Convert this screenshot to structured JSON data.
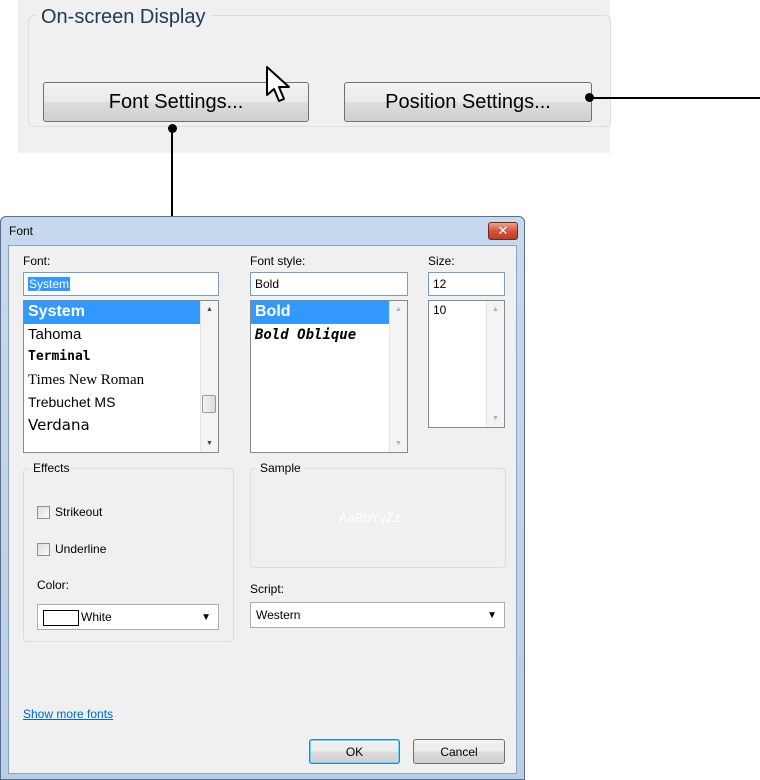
{
  "osd": {
    "group_title": "On-screen Display",
    "font_settings_label": "Font Settings...",
    "position_settings_label": "Position Settings..."
  },
  "dialog": {
    "title": "Font",
    "close_glyph": "✕",
    "font": {
      "label": "Font:",
      "value": "System",
      "items": [
        "System",
        "Tahoma",
        "Terminal",
        "Times New Roman",
        "Trebuchet MS",
        "Verdana"
      ],
      "selected": "System"
    },
    "style": {
      "label": "Font style:",
      "value": "Bold",
      "items": [
        "Bold",
        "Bold Oblique"
      ],
      "selected": "Bold"
    },
    "size": {
      "label": "Size:",
      "value": "12",
      "items": [
        "10"
      ]
    },
    "effects": {
      "title": "Effects",
      "strikeout_label": "Strikeout",
      "strikeout_checked": false,
      "underline_label": "Underline",
      "underline_checked": false,
      "color_label": "Color:",
      "color_value": "White",
      "color_swatch": "#ffffff"
    },
    "sample": {
      "title": "Sample",
      "text": "AaBbYyZz"
    },
    "script": {
      "label": "Script:",
      "value": "Western"
    },
    "show_more_fonts": "Show more fonts",
    "ok_label": "OK",
    "cancel_label": "Cancel"
  },
  "icons": {
    "cursor": "arrow-cursor-icon",
    "scroll_up": "▲",
    "scroll_down": "▼",
    "dropdown": "▼"
  }
}
